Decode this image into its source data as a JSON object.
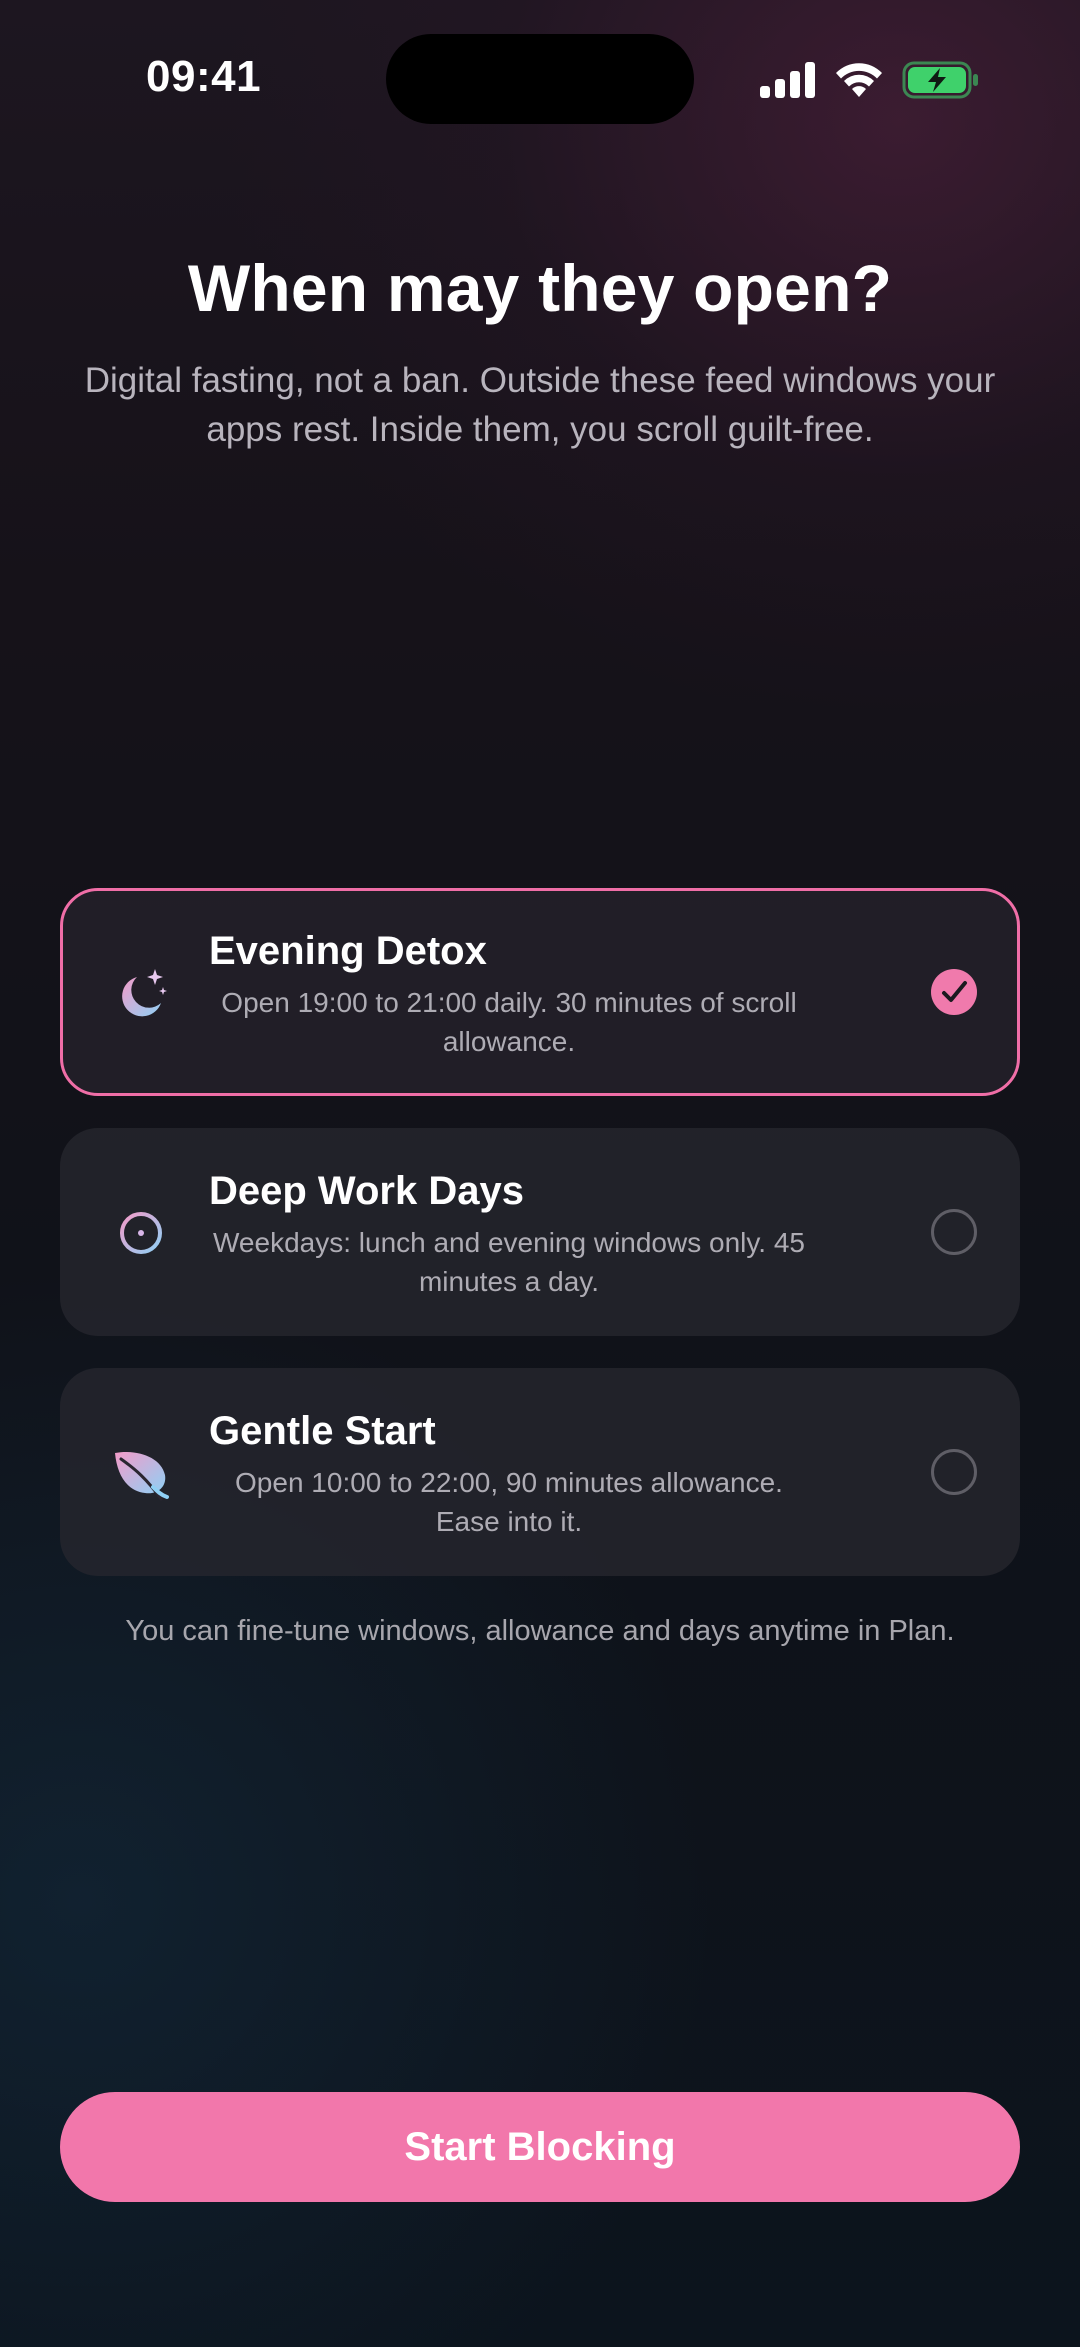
{
  "status_bar": {
    "time": "09:41",
    "signal_icon": "cellular-signal-icon",
    "wifi_icon": "wifi-icon",
    "battery_icon": "battery-charging-icon",
    "battery_color": "#3fd16b"
  },
  "header": {
    "title": "When may they open?",
    "subtitle": "Digital fasting, not a ban. Outside these feed windows your apps rest. Inside them, you scroll guilt-free."
  },
  "options": [
    {
      "icon": "moon-stars-icon",
      "title": "Evening Detox",
      "description": "Open 19:00 to 21:00 daily. 30 minutes of scroll allowance.",
      "selected": true
    },
    {
      "icon": "crosshair-target-icon",
      "title": "Deep Work Days",
      "description": "Weekdays: lunch and evening windows only. 45 minutes a day.",
      "selected": false
    },
    {
      "icon": "leaf-icon",
      "title": "Gentle Start",
      "description": "Open 10:00 to 22:00, 90 minutes allowance. Ease into it.",
      "selected": false
    }
  ],
  "footnote": "You can fine-tune windows, allowance and days anytime in Plan.",
  "primary_button": {
    "label": "Start Blocking"
  },
  "colors": {
    "accent": "#f277ab",
    "selected_border": "#f06ea7",
    "card_background": "#26262e",
    "text_secondary": "#aeacb4"
  }
}
